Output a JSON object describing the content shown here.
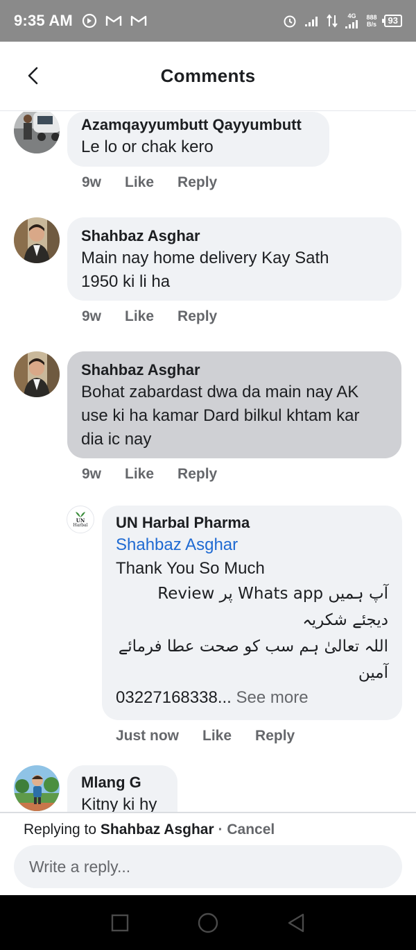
{
  "status_bar": {
    "time": "9:35 AM",
    "speed_top": "888",
    "speed_bottom": "B/s",
    "network": "4G",
    "battery": "93"
  },
  "header": {
    "title": "Comments",
    "back_icon": "chevron-left-icon"
  },
  "comments": [
    {
      "name": "Azamqayyumbutt Qayyumbutt",
      "text": "Le lo or chak kero",
      "time": "9w",
      "like": "Like",
      "reply": "Reply"
    },
    {
      "name": "Shahbaz Asghar",
      "text": "Main nay home delivery Kay Sath\n1950 ki li ha",
      "time": "9w",
      "like": "Like",
      "reply": "Reply"
    },
    {
      "name": "Shahbaz Asghar",
      "text": "Bohat zabardast dwa da main nay AK\nuse ki ha kamar Dard bilkul khtam kar\ndia ic nay",
      "time": "9w",
      "like": "Like",
      "reply": "Reply"
    },
    {
      "name": "Mlang G",
      "text": "Kitny ki hy"
    }
  ],
  "reply_comment": {
    "name": "UN Harbal Pharma",
    "avatar_text_top": "UN",
    "avatar_text_bottom": "Harbal",
    "mention": "Shahbaz Asghar",
    "text": "Thank You So Much",
    "urdu_lines": [
      "آپ ہمیں Whats app پر Review",
      "دیجئے شکریہ",
      "اللہ تعالیٰ ہم سب کو صحت عطا فرمائے",
      "آمین"
    ],
    "phone": "03227168338...",
    "see_more": "See more",
    "time": "Just now",
    "like": "Like",
    "reply": "Reply"
  },
  "reply_box": {
    "prefix": "Replying to",
    "name": "Shahbaz Asghar",
    "separator": " · ",
    "cancel": "Cancel",
    "placeholder": "Write a reply..."
  },
  "colors": {
    "bubble": "#f0f2f5",
    "bubble_highlight": "#cfd0d4",
    "mention": "#1f6ad2",
    "muted": "#65676b"
  }
}
